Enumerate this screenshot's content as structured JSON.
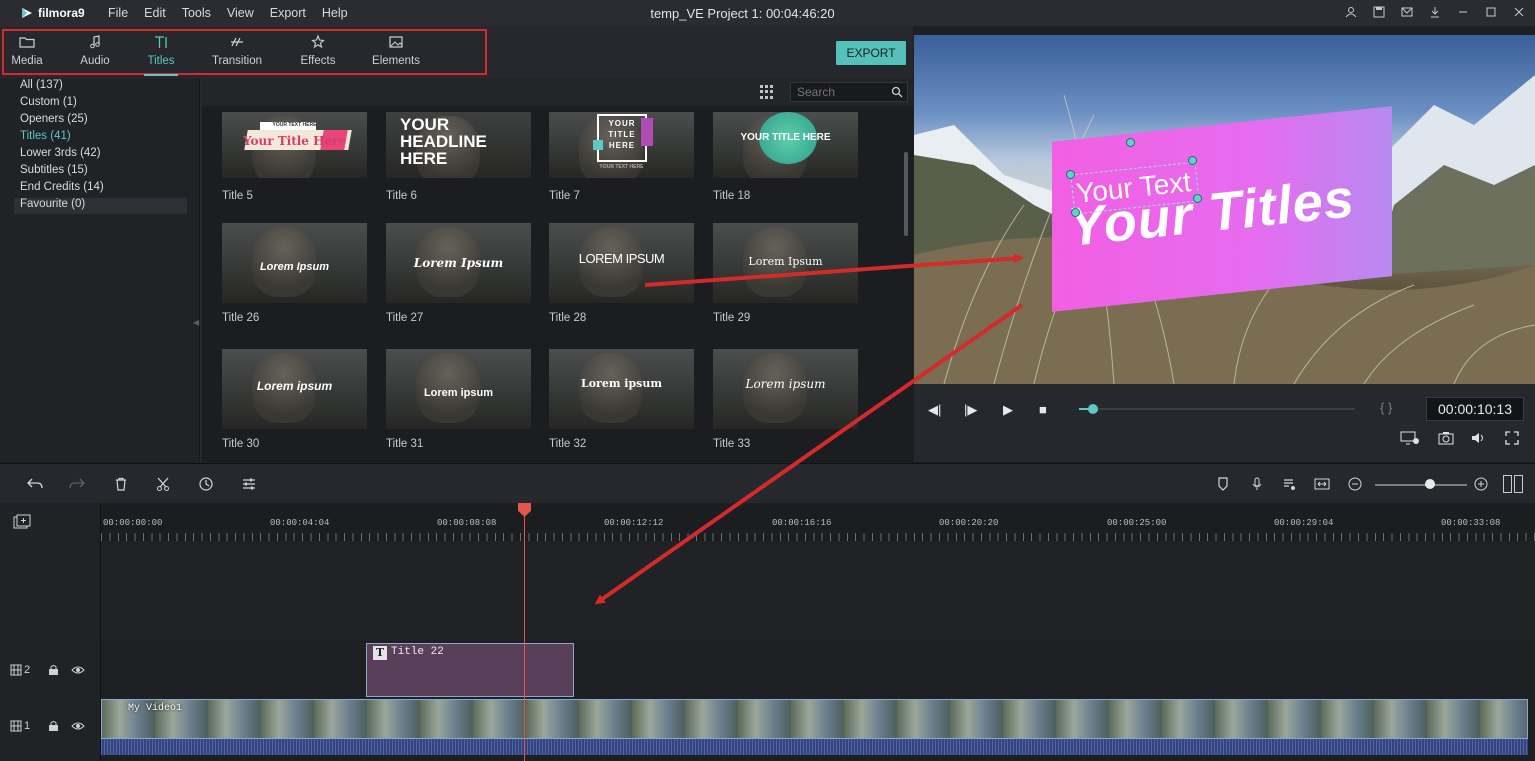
{
  "app": {
    "logo_text": "filmora9",
    "menu": [
      "File",
      "Edit",
      "Tools",
      "View",
      "Export",
      "Help"
    ],
    "window_title": "temp_VE Project 1: 00:04:46:20"
  },
  "library": {
    "tabs": [
      {
        "label": "Media",
        "icon": "folder-icon"
      },
      {
        "label": "Audio",
        "icon": "music-note-icon"
      },
      {
        "label": "Titles",
        "icon": "title-t-icon",
        "active": true
      },
      {
        "label": "Transition",
        "icon": "transition-icon"
      },
      {
        "label": "Effects",
        "icon": "effects-icon"
      },
      {
        "label": "Elements",
        "icon": "image-icon"
      }
    ],
    "export_label": "EXPORT",
    "categories": [
      "All (137)",
      "Custom (1)",
      "Openers (25)",
      "Titles (41)",
      "Lower 3rds (42)",
      "Subtitles (15)",
      "End Credits (14)",
      "Favourite (0)"
    ],
    "active_category": "Titles (41)",
    "search_placeholder": "Search",
    "thumbnails": [
      {
        "label": "Title 5",
        "text": "Your Title Here",
        "small": "YOUR TEXT HERE"
      },
      {
        "label": "Title 6",
        "text": "YOUR HEADLINE HERE"
      },
      {
        "label": "Title 7",
        "text": "YOUR TITLE HERE",
        "small": "YOUR TEXT HERE"
      },
      {
        "label": "Title 18",
        "text": "YOUR TITLE HERE"
      },
      {
        "label": "Title 26",
        "text": "Lorem Ipsum"
      },
      {
        "label": "Title 27",
        "text": "Lorem Ipsum"
      },
      {
        "label": "Title 28",
        "text": "LOREM IPSUM"
      },
      {
        "label": "Title 29",
        "text": "Lorem Ipsum"
      },
      {
        "label": "Title 30",
        "text": "Lorem ipsum"
      },
      {
        "label": "Title 31",
        "text": "Lorem ipsum"
      },
      {
        "label": "Title 32",
        "text": "Lorem ipsum"
      },
      {
        "label": "Title 33",
        "text": "Lorem ipsum"
      }
    ]
  },
  "preview": {
    "main_text": "Your Titles",
    "sub_text": "Your Text",
    "timecode": "00:00:10:13",
    "progress": 0.05,
    "brackets": "{ }"
  },
  "toolbar": {
    "zoom_level": 0.6
  },
  "timeline": {
    "ruler_labels": [
      "00:00:00:00",
      "00:00:04:04",
      "00:00:08:08",
      "00:00:12:12",
      "00:00:16:16",
      "00:00:20:20",
      "00:00:25:00",
      "00:00:29:04",
      "00:00:33:08"
    ],
    "tracks": [
      {
        "number": "2"
      },
      {
        "number": "1"
      }
    ],
    "title_clip_name": "Title 22",
    "video_clip_name": "My Video1"
  },
  "colors": {
    "accent": "#5ec8c4",
    "annotation_red": "#d32b2b",
    "playhead": "#e4564a",
    "title_card": "#f25fe2"
  }
}
